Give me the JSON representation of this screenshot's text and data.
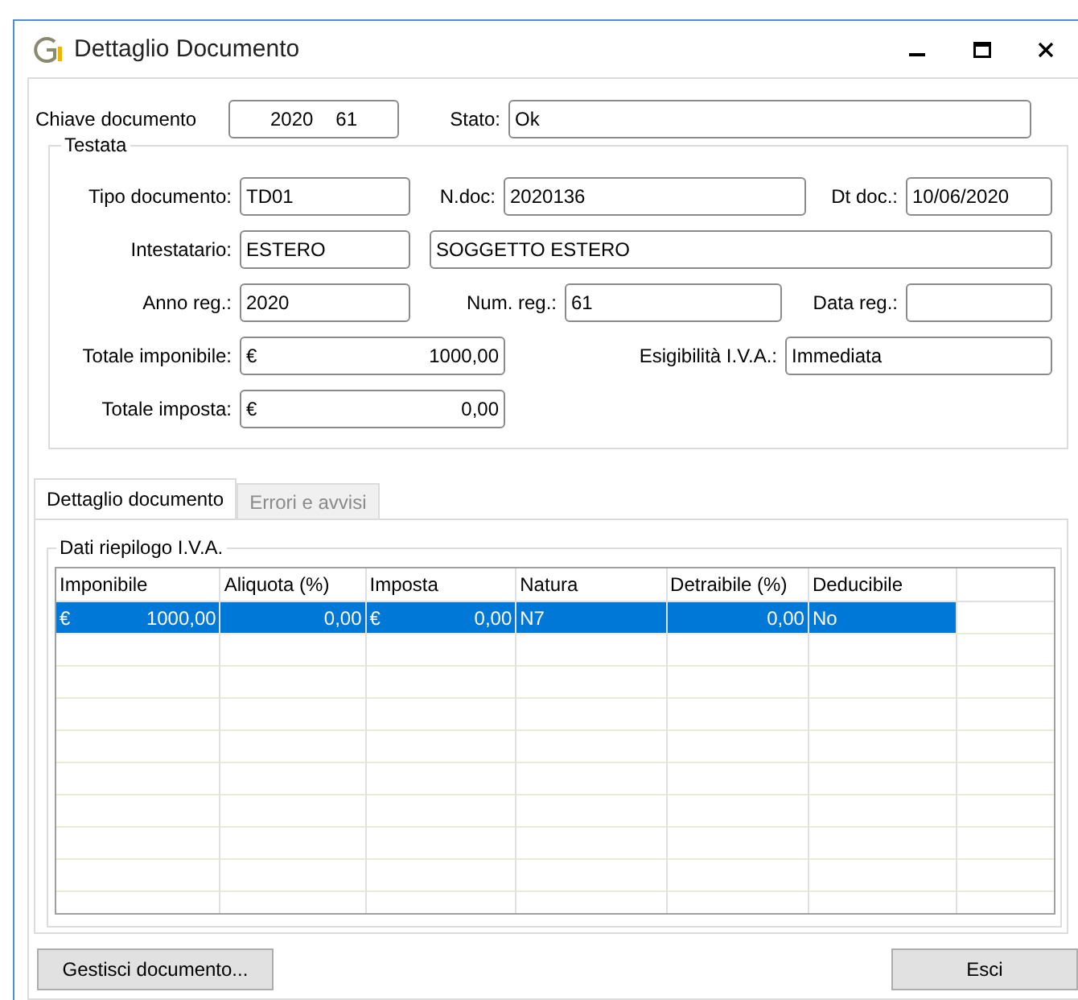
{
  "window": {
    "title": "Dettaglio Documento"
  },
  "chiave": {
    "label": "Chiave documento",
    "year": "2020",
    "number": "61"
  },
  "stato": {
    "label": "Stato:",
    "value": "Ok"
  },
  "testata": {
    "title": "Testata",
    "tipo_documento": {
      "label": "Tipo documento:",
      "value": "TD01"
    },
    "n_doc": {
      "label": "N.doc:",
      "value": "2020136"
    },
    "dt_doc": {
      "label": "Dt doc.:",
      "value": "10/06/2020"
    },
    "intestatario": {
      "label": "Intestatario:",
      "code": "ESTERO",
      "name": "SOGGETTO ESTERO"
    },
    "anno_reg": {
      "label": "Anno reg.:",
      "value": "2020"
    },
    "num_reg": {
      "label": "Num. reg.:",
      "value": "61"
    },
    "data_reg": {
      "label": "Data reg.:"
    },
    "totale_imponibile": {
      "label": "Totale imponibile:",
      "currency": "€",
      "value": "1000,00"
    },
    "esigibilita": {
      "label": "Esigibilità I.V.A.:",
      "value": "Immediata"
    },
    "totale_imposta": {
      "label": "Totale imposta:",
      "currency": "€",
      "value": "0,00"
    }
  },
  "tabs": [
    {
      "label": "Dettaglio documento",
      "selected": true
    },
    {
      "label": "Errori e avvisi",
      "selected": false
    }
  ],
  "riepilogo": {
    "title": "Dati riepilogo I.V.A.",
    "columns": [
      "Imponibile",
      "Aliquota (%)",
      "Imposta",
      "Natura",
      "Detraibile (%)",
      "Deducibile"
    ],
    "rows": [
      {
        "selected": true,
        "cells": [
          {
            "kind": "amount",
            "currency": "€",
            "value": "1000,00"
          },
          {
            "kind": "number",
            "value": "0,00"
          },
          {
            "kind": "amount",
            "currency": "€",
            "value": "0,00"
          },
          {
            "kind": "text",
            "value": "N7"
          },
          {
            "kind": "number",
            "value": "0,00"
          },
          {
            "kind": "text",
            "value": "No"
          }
        ]
      }
    ]
  },
  "buttons": [
    {
      "label": "Gestisci documento..."
    },
    {
      "label": "Esci"
    }
  ]
}
